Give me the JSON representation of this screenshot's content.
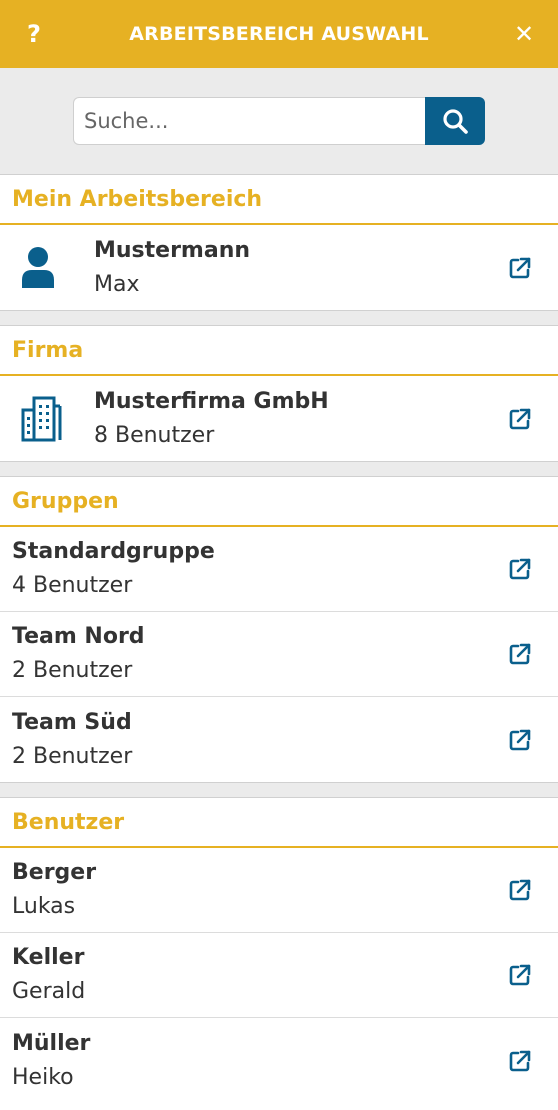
{
  "header": {
    "help_label": "?",
    "title": "ARBEITSBEREICH AUSWAHL",
    "close_label": "✕"
  },
  "search": {
    "placeholder": "Suche..."
  },
  "sections": {
    "mine": {
      "title": "Mein Arbeitsbereich",
      "item": {
        "primary": "Mustermann",
        "secondary": "Max"
      }
    },
    "company": {
      "title": "Firma",
      "item": {
        "primary": "Musterfirma GmbH",
        "secondary": "8 Benutzer"
      }
    },
    "groups": {
      "title": "Gruppen",
      "items": [
        {
          "primary": "Standardgruppe",
          "secondary": "4 Benutzer"
        },
        {
          "primary": "Team Nord",
          "secondary": "2 Benutzer"
        },
        {
          "primary": "Team Süd",
          "secondary": "2 Benutzer"
        }
      ]
    },
    "users": {
      "title": "Benutzer",
      "items": [
        {
          "primary": "Berger",
          "secondary": "Lukas"
        },
        {
          "primary": "Keller",
          "secondary": "Gerald"
        },
        {
          "primary": "Müller",
          "secondary": "Heiko"
        }
      ]
    }
  },
  "colors": {
    "accent": "#e6b123",
    "primary_blue": "#0a5f8c"
  },
  "icons": {
    "help": "question-icon",
    "close": "close-icon",
    "search": "search-icon",
    "person": "person-icon",
    "building": "building-icon",
    "open": "external-link-icon"
  }
}
